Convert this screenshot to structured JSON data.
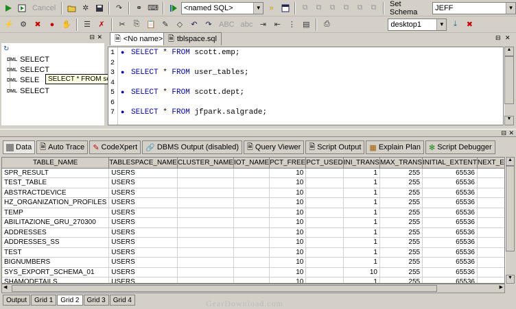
{
  "toolbar1": {
    "cancel_label": "Cancel",
    "named_sql_value": "<named SQL>",
    "set_schema_label": "Set Schema",
    "schema_value": "JEFF"
  },
  "toolbar2": {
    "desktop_value": "desktop1",
    "abc_upper": "ABC",
    "abc_lower": "abc"
  },
  "tree": {
    "items": [
      {
        "badge": "DML",
        "label": "SELECT"
      },
      {
        "badge": "DML",
        "label": "SELECT"
      },
      {
        "badge": "DML",
        "label": "SELE"
      },
      {
        "badge": "DML",
        "label": "SELECT"
      }
    ],
    "tooltip": "SELECT * FROM scott.emp"
  },
  "editor_tabs": [
    "<No name>",
    "tblspace.sql"
  ],
  "editor": {
    "line_numbers": [
      "1",
      "2",
      "3",
      "4",
      "5",
      "6",
      "7"
    ],
    "statements": [
      {
        "kw1": "SELECT",
        "star": " * ",
        "kw2": "FROM",
        "obj": " scott.emp;"
      },
      {
        "kw1": "SELECT",
        "star": " * ",
        "kw2": "FROM",
        "obj": " user_tables;"
      },
      {
        "kw1": "SELECT",
        "star": " * ",
        "kw2": "FROM",
        "obj": " scott.dept;"
      },
      {
        "kw1": "SELECT",
        "star": " * ",
        "kw2": "FROM",
        "obj": " jfpark.salgrade;"
      }
    ]
  },
  "result_tabs": [
    "Data",
    "Auto Trace",
    "CodeXpert",
    "DBMS Output (disabled)",
    "Query Viewer",
    "Script Output",
    "Explain Plan",
    "Script Debugger"
  ],
  "grid": {
    "columns": [
      "TABLE_NAME",
      "TABLESPACE_NAME",
      "CLUSTER_NAME",
      "IOT_NAME",
      "PCT_FREE",
      "PCT_USED",
      "INI_TRANS",
      "MAX_TRANS",
      "INITIAL_EXTENT",
      "NEXT_EXTENT"
    ],
    "rows": [
      [
        "SPR_RESULT",
        "USERS",
        "",
        "",
        "10",
        "",
        "1",
        "255",
        "65536",
        ""
      ],
      [
        "TEST_TABLE",
        "USERS",
        "",
        "",
        "10",
        "",
        "1",
        "255",
        "65536",
        ""
      ],
      [
        "ABSTRACTDEVICE",
        "USERS",
        "",
        "",
        "10",
        "",
        "1",
        "255",
        "65536",
        ""
      ],
      [
        "HZ_ORGANIZATION_PROFILES",
        "USERS",
        "",
        "",
        "10",
        "",
        "1",
        "255",
        "65536",
        ""
      ],
      [
        "TEMP",
        "USERS",
        "",
        "",
        "10",
        "",
        "1",
        "255",
        "65536",
        ""
      ],
      [
        "ABILITAZIONE_GRU_270300",
        "USERS",
        "",
        "",
        "10",
        "",
        "1",
        "255",
        "65536",
        ""
      ],
      [
        "ADDRESSES",
        "USERS",
        "",
        "",
        "10",
        "",
        "1",
        "255",
        "65536",
        ""
      ],
      [
        "ADDRESSES_SS",
        "USERS",
        "",
        "",
        "10",
        "",
        "1",
        "255",
        "65536",
        ""
      ],
      [
        "TEST",
        "USERS",
        "",
        "",
        "10",
        "",
        "1",
        "255",
        "65536",
        ""
      ],
      [
        "BIGNUMBERS",
        "USERS",
        "",
        "",
        "10",
        "",
        "1",
        "255",
        "65536",
        ""
      ],
      [
        "SYS_EXPORT_SCHEMA_01",
        "USERS",
        "",
        "",
        "10",
        "",
        "10",
        "255",
        "65536",
        ""
      ],
      [
        "SHAMODETAILS",
        "USERS",
        "",
        "",
        "10",
        "",
        "1",
        "255",
        "65536",
        ""
      ]
    ]
  },
  "bottom_tabs": [
    "Output",
    "Grid 1",
    "Grid 2",
    "Grid 3",
    "Grid 4"
  ],
  "watermark": "GearDownload.com"
}
